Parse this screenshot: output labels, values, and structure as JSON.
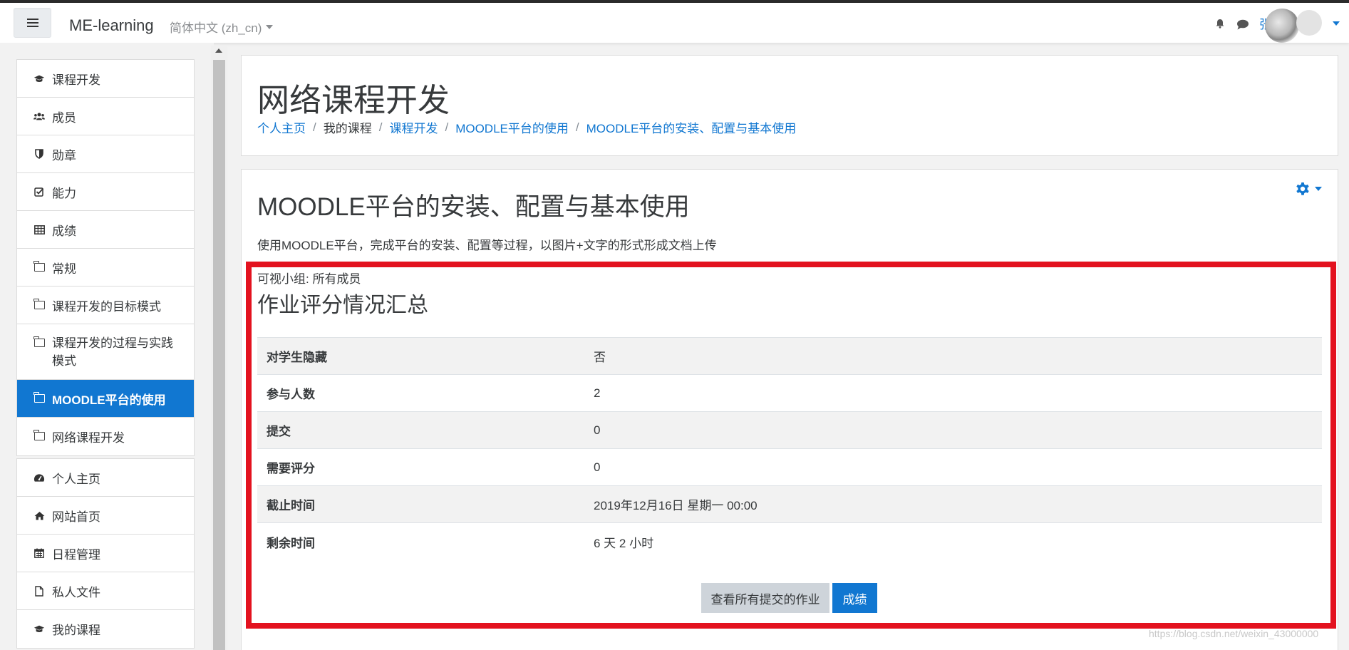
{
  "navbar": {
    "brand": "ME-learning",
    "language": "简体中文 (zh_cn)",
    "user_name": "张"
  },
  "sidebar": {
    "course_items": [
      {
        "label": "课程开发",
        "icon": "graduation-cap-icon"
      },
      {
        "label": "成员",
        "icon": "users-icon"
      },
      {
        "label": "勋章",
        "icon": "shield-icon"
      },
      {
        "label": "能力",
        "icon": "checkbox-icon"
      },
      {
        "label": "成绩",
        "icon": "table-icon"
      },
      {
        "label": "常规",
        "icon": "folder-icon"
      },
      {
        "label": "课程开发的目标模式",
        "icon": "folder-icon"
      },
      {
        "label": "课程开发的过程与实践模式",
        "icon": "folder-icon"
      },
      {
        "label": "MOODLE平台的使用",
        "icon": "folder-icon",
        "active": true
      },
      {
        "label": "网络课程开发",
        "icon": "folder-icon"
      }
    ],
    "site_items": [
      {
        "label": "个人主页",
        "icon": "dashboard-icon"
      },
      {
        "label": "网站首页",
        "icon": "home-icon"
      },
      {
        "label": "日程管理",
        "icon": "calendar-icon"
      },
      {
        "label": "私人文件",
        "icon": "file-icon"
      },
      {
        "label": "我的课程",
        "icon": "graduation-cap-icon"
      }
    ]
  },
  "header": {
    "title": "网络课程开发",
    "breadcrumb": [
      {
        "label": "个人主页",
        "link": true
      },
      {
        "label": "我的课程",
        "link": false
      },
      {
        "label": "课程开发",
        "link": true
      },
      {
        "label": "MOODLE平台的使用",
        "link": true
      },
      {
        "label": "MOODLE平台的安装、配置与基本使用",
        "link": true
      }
    ]
  },
  "main": {
    "activity_title": "MOODLE平台的安装、配置与基本使用",
    "intro": "使用MOODLE平台，完成平台的安装、配置等过程，以图片+文字的形式形成文档上传",
    "group_label": "可视小组: 所有成员",
    "grading_title": "作业评分情况汇总",
    "summary": [
      {
        "key": "对学生隐藏",
        "value": "否"
      },
      {
        "key": "参与人数",
        "value": "2"
      },
      {
        "key": "提交",
        "value": "0"
      },
      {
        "key": "需要评分",
        "value": "0"
      },
      {
        "key": "截止时间",
        "value": "2019年12月16日 星期一 00:00"
      },
      {
        "key": "剩余时间",
        "value": "6 天 2 小时"
      }
    ],
    "view_all_button": "查看所有提交的作业",
    "grade_button": "成绩"
  },
  "watermark": "https://blog.csdn.net/weixin_43000000",
  "colors": {
    "accent": "#1177d1",
    "highlight_border": "#e3121f",
    "page_bg": "#f2f2f2"
  }
}
